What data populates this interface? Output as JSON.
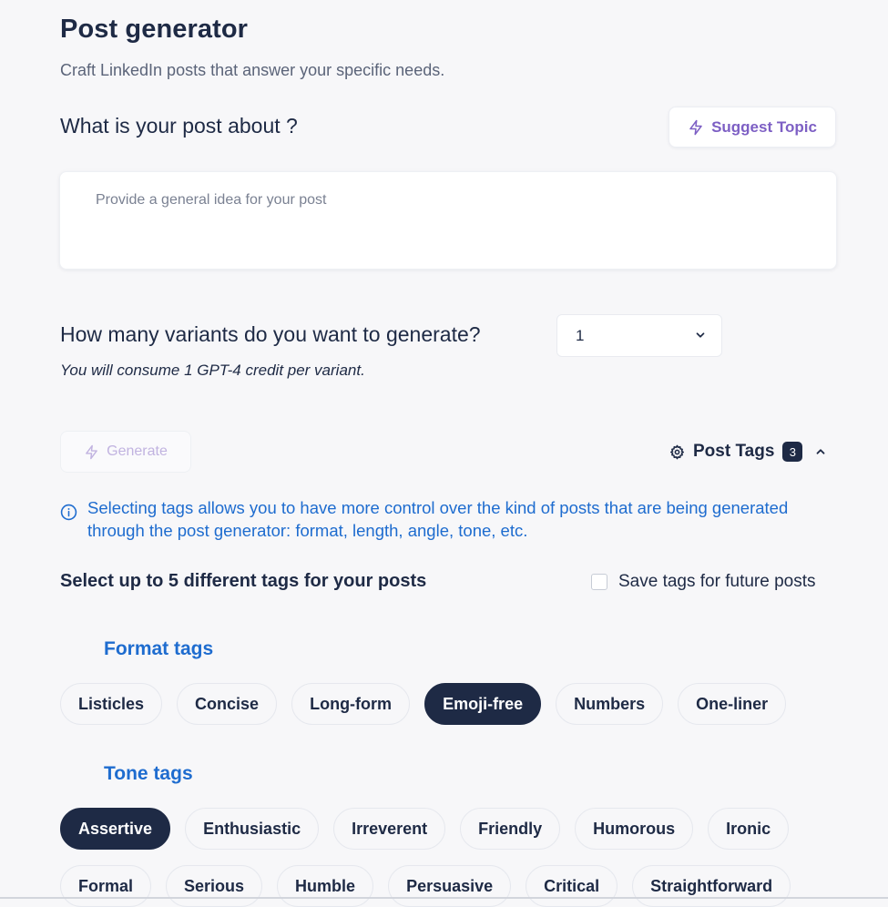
{
  "header": {
    "title": "Post generator",
    "subtitle": "Craft LinkedIn posts that answer your specific needs."
  },
  "topic": {
    "question": "What is your post about ?",
    "suggest_label": "Suggest Topic",
    "placeholder": "Provide a general idea for your post"
  },
  "variants": {
    "question": "How many variants do you want to generate?",
    "selected": "1",
    "credit_note": "You will consume 1 GPT-4 credit per variant."
  },
  "generate": {
    "label": "Generate"
  },
  "post_tags": {
    "label": "Post Tags",
    "count": "3"
  },
  "info": {
    "text": "Selecting tags allows you to have more control over the kind of posts that are being generated through the post generator: format, length, angle, tone, etc."
  },
  "tags_header": {
    "title": "Select up to 5 different tags for your posts",
    "save_label": "Save tags for future posts"
  },
  "format_tags": {
    "title": "Format tags",
    "items": [
      {
        "label": "Listicles",
        "active": false
      },
      {
        "label": "Concise",
        "active": false
      },
      {
        "label": "Long-form",
        "active": false
      },
      {
        "label": "Emoji-free",
        "active": true
      },
      {
        "label": "Numbers",
        "active": false
      },
      {
        "label": "One-liner",
        "active": false
      }
    ]
  },
  "tone_tags": {
    "title": "Tone tags",
    "row1": [
      {
        "label": "Assertive",
        "active": true
      },
      {
        "label": "Enthusiastic",
        "active": false
      },
      {
        "label": "Irreverent",
        "active": false
      },
      {
        "label": "Friendly",
        "active": false
      },
      {
        "label": "Humorous",
        "active": false
      },
      {
        "label": "Ironic",
        "active": false
      }
    ],
    "row2": [
      {
        "label": "Formal",
        "active": false
      },
      {
        "label": "Serious",
        "active": false
      },
      {
        "label": "Humble",
        "active": false
      },
      {
        "label": "Persuasive",
        "active": false
      },
      {
        "label": "Critical",
        "active": false
      },
      {
        "label": "Straightforward",
        "active": false
      }
    ]
  },
  "colors": {
    "accent_purple": "#7d5fc4",
    "link_blue": "#1e6ccf",
    "dark_navy": "#1e2a45"
  }
}
